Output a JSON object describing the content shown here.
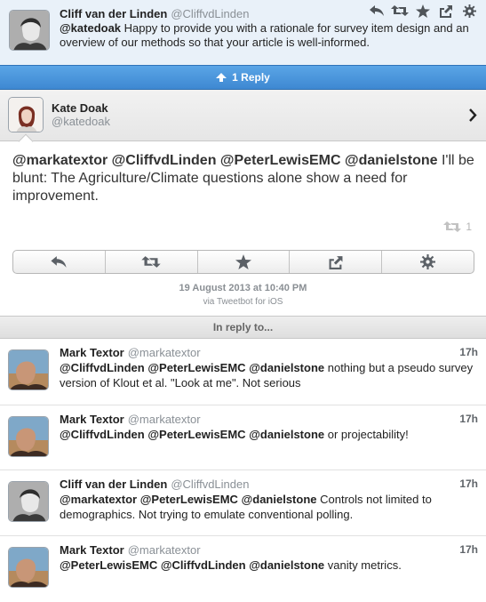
{
  "top_tweet": {
    "name": "Cliff van der Linden",
    "handle": "@CliffvdLinden",
    "mention": "@katedoak",
    "text": " Happy to provide you with a rationale for survey item design and an overview of our methods so that your article is well-informed."
  },
  "reply_bar": {
    "label": "1 Reply"
  },
  "author": {
    "name": "Kate Doak",
    "handle": "@katedoak"
  },
  "main_tweet": {
    "mentions": [
      "@markatextor",
      "@CliffvdLinden",
      "@PeterLewisEMC",
      "@danielstone"
    ],
    "text": " I'll be blunt: The Agriculture/Climate questions alone show a need for improvement.",
    "retweet_count": "1",
    "date": "19 August 2013 at 10:40 PM",
    "via": "via Tweetbot for iOS"
  },
  "in_reply_to": {
    "label": "In reply to..."
  },
  "replies": [
    {
      "name": "Mark Textor",
      "handle": "@markatextor",
      "time": "17h",
      "mentions": [
        "@CliffvdLinden",
        "@PeterLewisEMC",
        "@danielstone"
      ],
      "text": " nothing but a pseudo survey version of Klout et al. \"Look at me\". Not serious"
    },
    {
      "name": "Mark Textor",
      "handle": "@markatextor",
      "time": "17h",
      "mentions": [
        "@CliffvdLinden",
        "@PeterLewisEMC",
        "@danielstone"
      ],
      "text": " or projectability!"
    },
    {
      "name": "Cliff van der Linden",
      "handle": "@CliffvdLinden",
      "time": "17h",
      "mentions": [
        "@markatextor",
        "@PeterLewisEMC",
        "@danielstone"
      ],
      "text": " Controls not limited to demographics. Not trying to emulate conventional polling."
    },
    {
      "name": "Mark Textor",
      "handle": "@markatextor",
      "time": "17h",
      "mentions": [
        "@PeterLewisEMC",
        "@CliffvdLinden",
        "@danielstone"
      ],
      "text": " vanity metrics."
    }
  ],
  "icons": {
    "reply": "reply-icon",
    "retweet": "retweet-icon",
    "favorite": "star-icon",
    "share": "share-icon",
    "settings": "gear-icon",
    "chevron": "chevron-right-icon"
  },
  "colors": {
    "reply_bar": "#3e88d2",
    "top_bg": "#e9f1f9"
  }
}
